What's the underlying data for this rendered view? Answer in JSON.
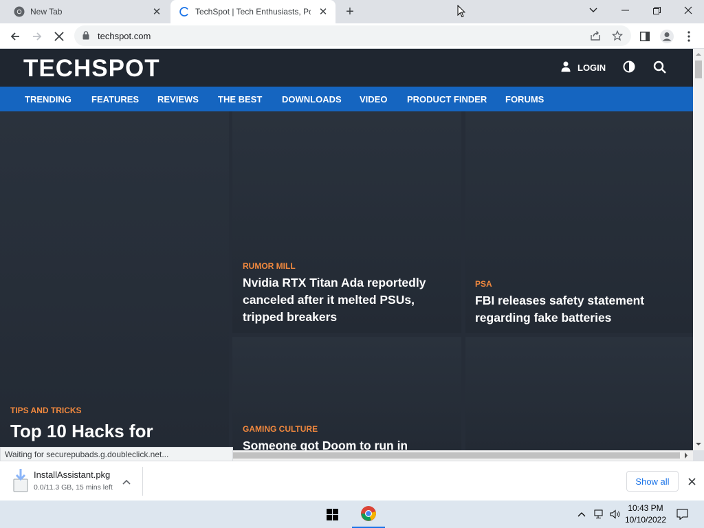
{
  "browser": {
    "tabs": [
      {
        "title": "New Tab",
        "favicon": "chrome-icon",
        "active": false
      },
      {
        "title": "TechSpot | Tech Enthusiasts, Power Users",
        "favicon": "loading-spinner-icon",
        "active": true
      }
    ],
    "address": "techspot.com",
    "status_text": "Waiting for securepubads.g.doubleclick.net..."
  },
  "site": {
    "logo_text": "TECHSPOT",
    "login_label": "LOGIN",
    "nav": [
      "TRENDING",
      "FEATURES",
      "REVIEWS",
      "THE BEST",
      "DOWNLOADS",
      "VIDEO",
      "PRODUCT FINDER",
      "FORUMS"
    ],
    "colors": {
      "header": "#1f2630",
      "nav": "#1565c0",
      "category": "#f0883e",
      "logo_accent": "#f5a623"
    }
  },
  "articles": [
    {
      "category": "TIPS AND TRICKS",
      "headline": "Top 10 Hacks for"
    },
    {
      "category": "RUMOR MILL",
      "headline": "Nvidia RTX Titan Ada reportedly canceled after it melted PSUs, tripped breakers"
    },
    {
      "category": "PSA",
      "headline": "FBI releases safety statement regarding fake batteries"
    },
    {
      "category": "GAMING CULTURE",
      "headline": "Someone got Doom to run in"
    }
  ],
  "downloads": {
    "file_name": "InstallAssistant.pkg",
    "status": "0.0/11.3 GB, 15 mins left",
    "show_all_label": "Show all"
  },
  "taskbar": {
    "time": "10:43 PM",
    "date": "10/10/2022"
  }
}
